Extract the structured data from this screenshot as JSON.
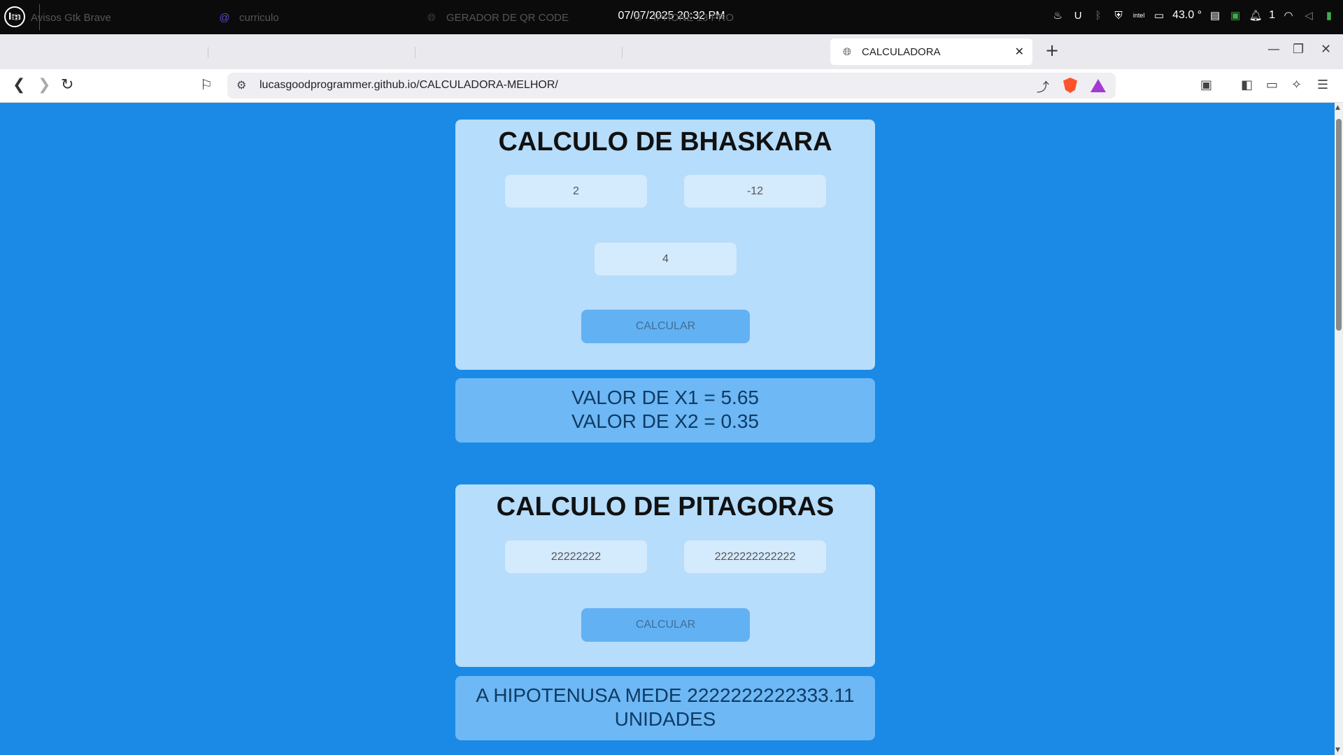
{
  "system_panel": {
    "logo": "lm",
    "clock": "07/07/2025 20:32 PM",
    "temperature": "43.0 °",
    "notification_count": "1"
  },
  "tabs": [
    {
      "title": "Avisos Gtk Brave",
      "icon": "brave-settings-icon"
    },
    {
      "title": "curriculo",
      "icon": "at-sign-icon"
    },
    {
      "title": "GERADOR DE QR CODE",
      "icon": "globe-icon"
    },
    {
      "title": "IPHONE 13 PRO",
      "icon": "globe-icon"
    },
    {
      "title": "CALCULADORA",
      "icon": "globe-icon",
      "active": true
    }
  ],
  "address_bar": {
    "url": "lucasgoodprogrammer.github.io/CALCULADORA-MELHOR/"
  },
  "bhaskara": {
    "title": "CALCULO DE BHASKARA",
    "input_a": "2",
    "input_b": "-12",
    "input_c": "4",
    "button": "CALCULAR",
    "result_x1": "VALOR DE X1 = 5.65",
    "result_x2": "VALOR DE X2 = 0.35"
  },
  "pitagoras": {
    "title": "CALCULO DE PITAGORAS",
    "input_a": "22222222",
    "input_b": "2222222222222",
    "button": "CALCULAR",
    "result_line1": "A HIPOTENUSA MEDE 2222222222333.11",
    "result_line2": "UNIDADES"
  },
  "colors": {
    "page_bg": "#1a8ae6",
    "card_bg": "#b6ddfb",
    "input_bg": "#d4eafd",
    "button_bg": "#62b1f3",
    "result_bg": "#6db8f5"
  }
}
